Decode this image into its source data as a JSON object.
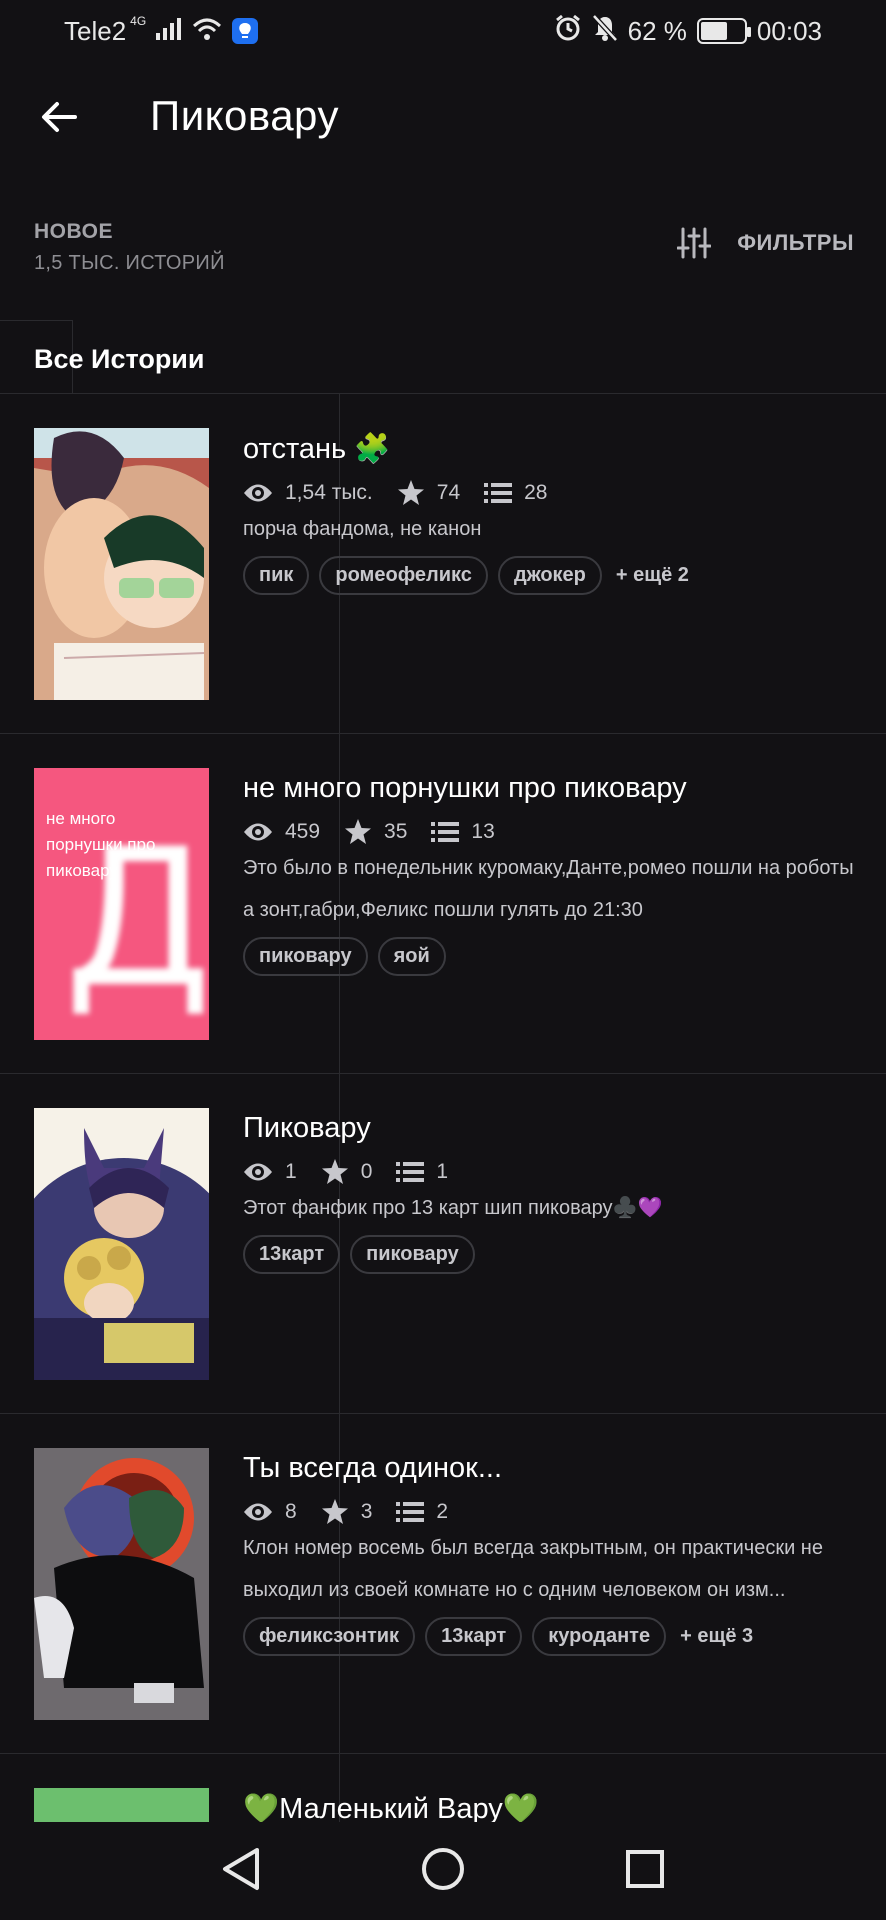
{
  "status_bar": {
    "carrier": "Tele2",
    "network": "4G",
    "battery_percent": "62 %",
    "battery_level": 0.62,
    "time": "00:03"
  },
  "header": {
    "title": "Пиковару"
  },
  "sort": {
    "label": "НОВОЕ",
    "count": "1,5 ТЫС. ИСТОРИЙ",
    "filters_label": "ФИЛЬТРЫ"
  },
  "tab": {
    "label": "Все Истории"
  },
  "stories": [
    {
      "title": "отстань 🧩",
      "views": "1,54 тыс.",
      "votes": "74",
      "parts": "28",
      "description": "порча фандома, не канон",
      "tags": [
        "пик",
        "ромеофеликс",
        "джокер"
      ],
      "more": "+ ещё 2"
    },
    {
      "title": "не много порнушки про пиковару",
      "views": "459",
      "votes": "35",
      "parts": "13",
      "description": "Это было в понедельник куромаку,Данте,ромео пошли на роботы а зонт,габри,Феликс пошли гулять до 21:30",
      "cover_text": "не много порнушки про пиковару",
      "cover_letter": "Д",
      "tags": [
        "пиковару",
        "яой"
      ],
      "more": ""
    },
    {
      "title": "Пиковару",
      "views": "1",
      "votes": "0",
      "parts": "1",
      "description": "Этот фанфик про 13 карт шип пиковару♣️💜",
      "tags": [
        "13карт",
        "пиковару"
      ],
      "more": ""
    },
    {
      "title": "Ты всегда одинок...",
      "views": "8",
      "votes": "3",
      "parts": "2",
      "description": "Клон номер восемь был всегда закрытным, он практически не выходил из своей комнате но с одним человеком он изм...",
      "tags": [
        "феликсзонтик",
        "13карт",
        "куроданте"
      ],
      "more": "+ ещё 3"
    },
    {
      "title": "💚Маленький Вару💚"
    }
  ],
  "colors": {
    "background": "#121114",
    "cover2_pink": "#f5577f",
    "cover5_green": "#6cbf6e",
    "vpn_blue": "#1e6ff0"
  }
}
